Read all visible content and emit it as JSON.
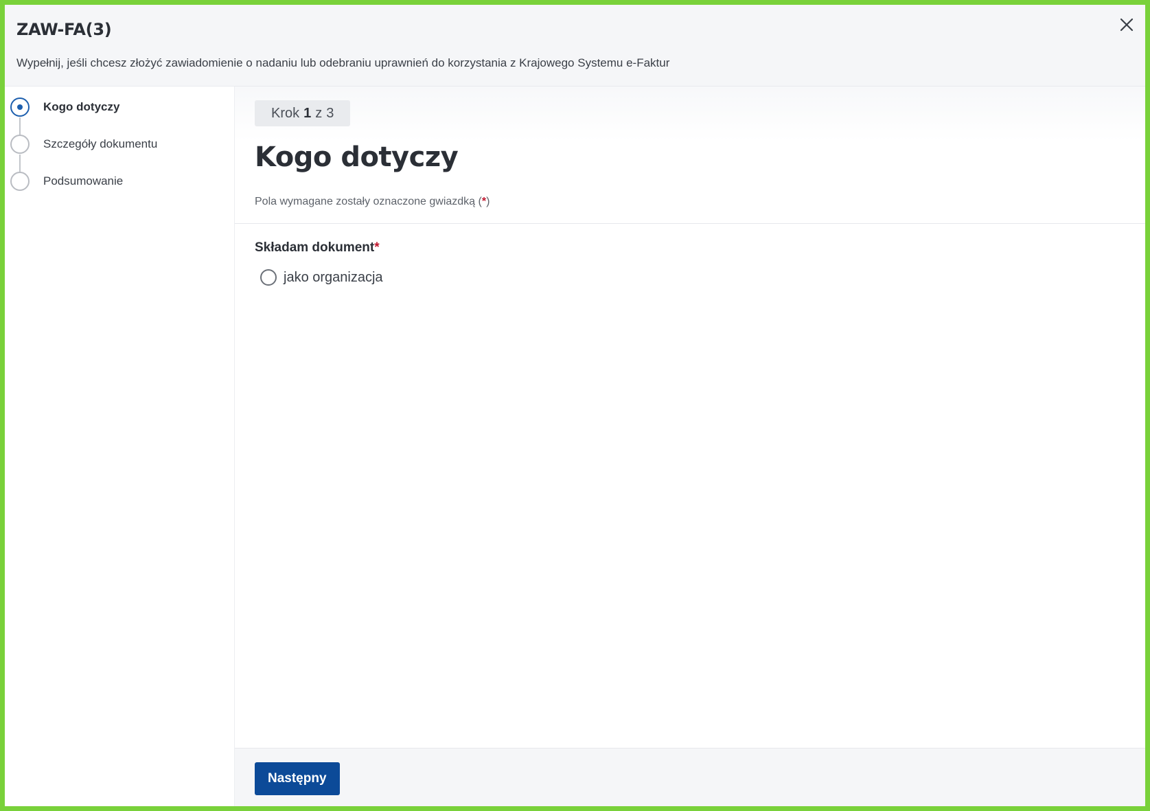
{
  "header": {
    "title": "ZAW-FA(3)",
    "description": "Wypełnij, jeśli chcesz złożyć zawiadomienie o nadaniu lub odebraniu uprawnień do korzystania z Krajowego Systemu e-Faktur"
  },
  "steps": [
    {
      "label": "Kogo dotyczy",
      "state": "active"
    },
    {
      "label": "Szczegóły dokumentu",
      "state": "pending"
    },
    {
      "label": "Podsumowanie",
      "state": "pending"
    }
  ],
  "main": {
    "step_badge": {
      "prefix": "Krok",
      "current": "1",
      "separator": "z",
      "total": "3"
    },
    "title": "Kogo dotyczy",
    "required_note": {
      "text": "Pola wymagane zostały oznaczone gwiazdką (",
      "star": "*",
      "close": ")"
    },
    "field": {
      "label": "Składam dokument",
      "required_star": "*",
      "options": [
        {
          "label": "jako organizacja",
          "checked": false
        }
      ]
    }
  },
  "footer": {
    "next_label": "Następny"
  },
  "colors": {
    "accent": "#0c4a98",
    "active_step": "#1d5fae",
    "required": "#c0172e",
    "frame": "#79d13a"
  }
}
